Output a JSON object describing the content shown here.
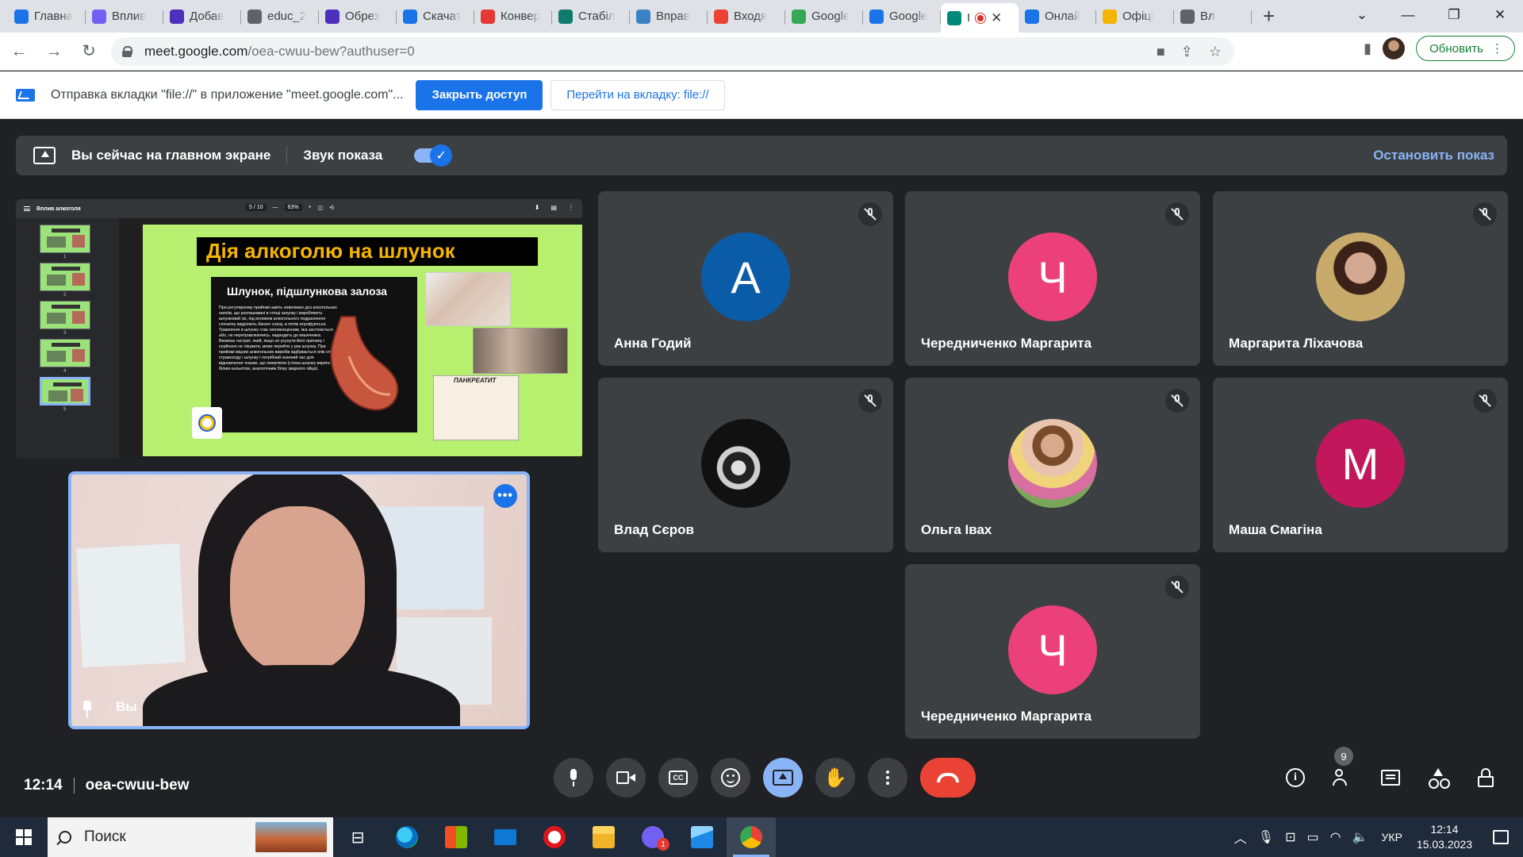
{
  "browser": {
    "tabs": [
      {
        "title": "Главна",
        "favicon": "chrome-icon",
        "color": "#1a73e8"
      },
      {
        "title": "Вплив",
        "favicon": "viber-icon",
        "color": "#7360f2"
      },
      {
        "title": "Добав",
        "favicon": "shield-icon",
        "color": "#4b2fbd"
      },
      {
        "title": "educ_2",
        "favicon": "globe-icon",
        "color": "#5f6368"
      },
      {
        "title": "Обрез",
        "favicon": "shield-icon",
        "color": "#4b2fbd"
      },
      {
        "title": "Скачат",
        "favicon": "thumb-icon",
        "color": "#1a73e8"
      },
      {
        "title": "Конвер",
        "favicon": "heart-icon",
        "color": "#e53935"
      },
      {
        "title": "Стабіл",
        "favicon": "sway-icon",
        "color": "#0f7b6c"
      },
      {
        "title": "Вправ",
        "favicon": "a-icon",
        "color": "#3b82c4"
      },
      {
        "title": "Входя",
        "favicon": "gmail-icon",
        "color": "#ea4335"
      },
      {
        "title": "Google",
        "favicon": "classroom-icon",
        "color": "#34a853"
      },
      {
        "title": "Google",
        "favicon": "calendar-icon",
        "color": "#1a73e8"
      },
      {
        "title": "I",
        "favicon": "meet-icon",
        "color": "#00897b",
        "active": true
      },
      {
        "title": "Онлай",
        "favicon": "target-icon",
        "color": "#1a73e8"
      },
      {
        "title": "Офіці",
        "favicon": "emblem-icon",
        "color": "#f4b400"
      },
      {
        "title": "Вл",
        "favicon": "globe-icon",
        "color": "#5f6368"
      }
    ],
    "url_host": "meet.google.com",
    "url_path": "/oea-cwuu-bew?authuser=0",
    "update_button": "Обновить"
  },
  "infobar": {
    "message": "Отправка вкладки \"file://\" в приложение \"meet.google.com\"...",
    "primary_button": "Закрыть доступ",
    "secondary_button": "Перейти на вкладку: file://"
  },
  "meet": {
    "banner": {
      "presenting_text": "Вы сейчас на главном экране",
      "audio_label": "Звук показа",
      "stop_link": "Остановить показ"
    },
    "shared_screen": {
      "pdf_title": "Вплив алкоголя",
      "page_indicator": "5 / 10",
      "zoom": "63%",
      "thumb_numbers": [
        "1",
        "2",
        "3",
        "4",
        "5"
      ],
      "slide_title": "Дія алкоголю на шлунок",
      "slide_subtitle": "Шлунок, підшлункова залоза",
      "slide_paragraph": "При регулярному прийомі навіть невеликих доз алкогольних напоїв, що розташовані в стінці шлунку і виробляють шлунковий сік, під впливом алкогольного подразнення спочатку виділяють багато слизу, а потім атрофуються. Травлення в шлунку стає неповноцінним, їжа застоюється або, не перетравлюючись, надходить до кишечника. Виникає гастрит, який, якщо не усунути його причину і серйозно не лікувати, може перейти у рак шлунку. При прийомі міцних алкогольних виробів відбувається опік стінок стравоходу і шлунку і потрібний значний час для відновлення тканин, що омертвіли (стінка шлунку вкрита білим нальотом, аналогічним білку зварного яйця).",
      "pancreas_label": "ПАНКРЕАТИТ"
    },
    "self": {
      "name": "Вы"
    },
    "participants": [
      {
        "name": "Анна Годий",
        "initial": "А",
        "color": "#0b5ca8"
      },
      {
        "name": "Чередниченко Маргарита",
        "initial": "Ч",
        "color": "#ec407a"
      },
      {
        "name": "Маргарита Ліхачова",
        "initial": "",
        "photo": "photo-girl"
      },
      {
        "name": "Влад Сєров",
        "initial": "",
        "photo": "photo-bw"
      },
      {
        "name": "Ольга Івах",
        "initial": "",
        "photo": "photo-olga"
      },
      {
        "name": "Маша Смагіна",
        "initial": "М",
        "color": "#c2185b"
      },
      {
        "name": "Чередниченко Маргарита",
        "initial": "Ч",
        "color": "#ec407a"
      }
    ],
    "time": "12:14",
    "meeting_code": "oea-cwuu-bew",
    "people_count": "9"
  },
  "taskbar": {
    "search_placeholder": "Поиск",
    "viber_badge": "1",
    "language": "УКР",
    "clock_time": "12:14",
    "clock_date": "15.03.2023"
  }
}
